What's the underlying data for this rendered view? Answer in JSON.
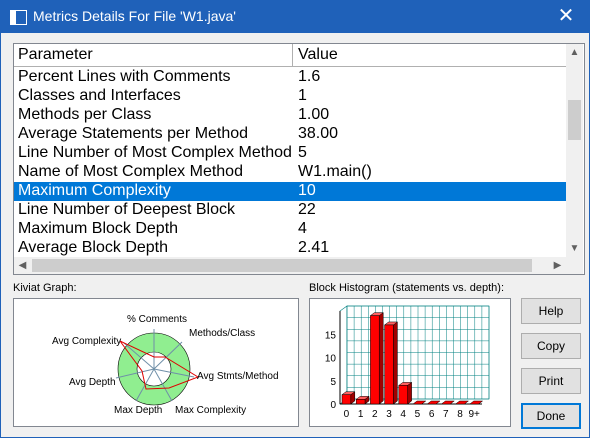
{
  "window": {
    "title": "Metrics Details For File 'W1.java'",
    "close_glyph": "✕"
  },
  "table": {
    "headers": [
      "Parameter",
      "Value"
    ],
    "rows": [
      {
        "param": "Percent Lines with Comments",
        "value": "1.6"
      },
      {
        "param": "Classes and Interfaces",
        "value": "1"
      },
      {
        "param": "Methods per Class",
        "value": "1.00"
      },
      {
        "param": "Average Statements per Method",
        "value": "38.00"
      },
      {
        "param": "Line Number of Most Complex Method",
        "value": "5"
      },
      {
        "param": "Name of Most Complex Method",
        "value": "W1.main()"
      },
      {
        "param": "Maximum Complexity",
        "value": "10"
      },
      {
        "param": "Line Number of Deepest Block",
        "value": "22"
      },
      {
        "param": "Maximum Block Depth",
        "value": "4"
      },
      {
        "param": "Average Block Depth",
        "value": "2.41"
      }
    ],
    "selected_index": 6
  },
  "kiviat": {
    "label": "Kiviat Graph:",
    "axes": [
      "% Comments",
      "Methods/Class",
      "Avg Stmts/Method",
      "Max Complexity",
      "Max Depth",
      "Avg Depth",
      "Avg Complexity"
    ]
  },
  "histogram": {
    "label": "Block Histogram (statements vs. depth):",
    "y_ticks": [
      "15",
      "10",
      "5",
      "0"
    ],
    "x_ticks": [
      "0",
      "1",
      "2",
      "3",
      "4",
      "5",
      "6",
      "7",
      "8",
      "9+"
    ],
    "values": [
      2,
      1,
      19,
      17,
      4,
      0,
      0,
      0,
      0,
      0
    ]
  },
  "buttons": {
    "help": "Help",
    "copy": "Copy",
    "print": "Print",
    "done": "Done"
  },
  "colors": {
    "titlebar": "#1f61b9",
    "selection": "#0078d7",
    "kiviat_band": "#90ee90",
    "bar": "#ff0000"
  }
}
